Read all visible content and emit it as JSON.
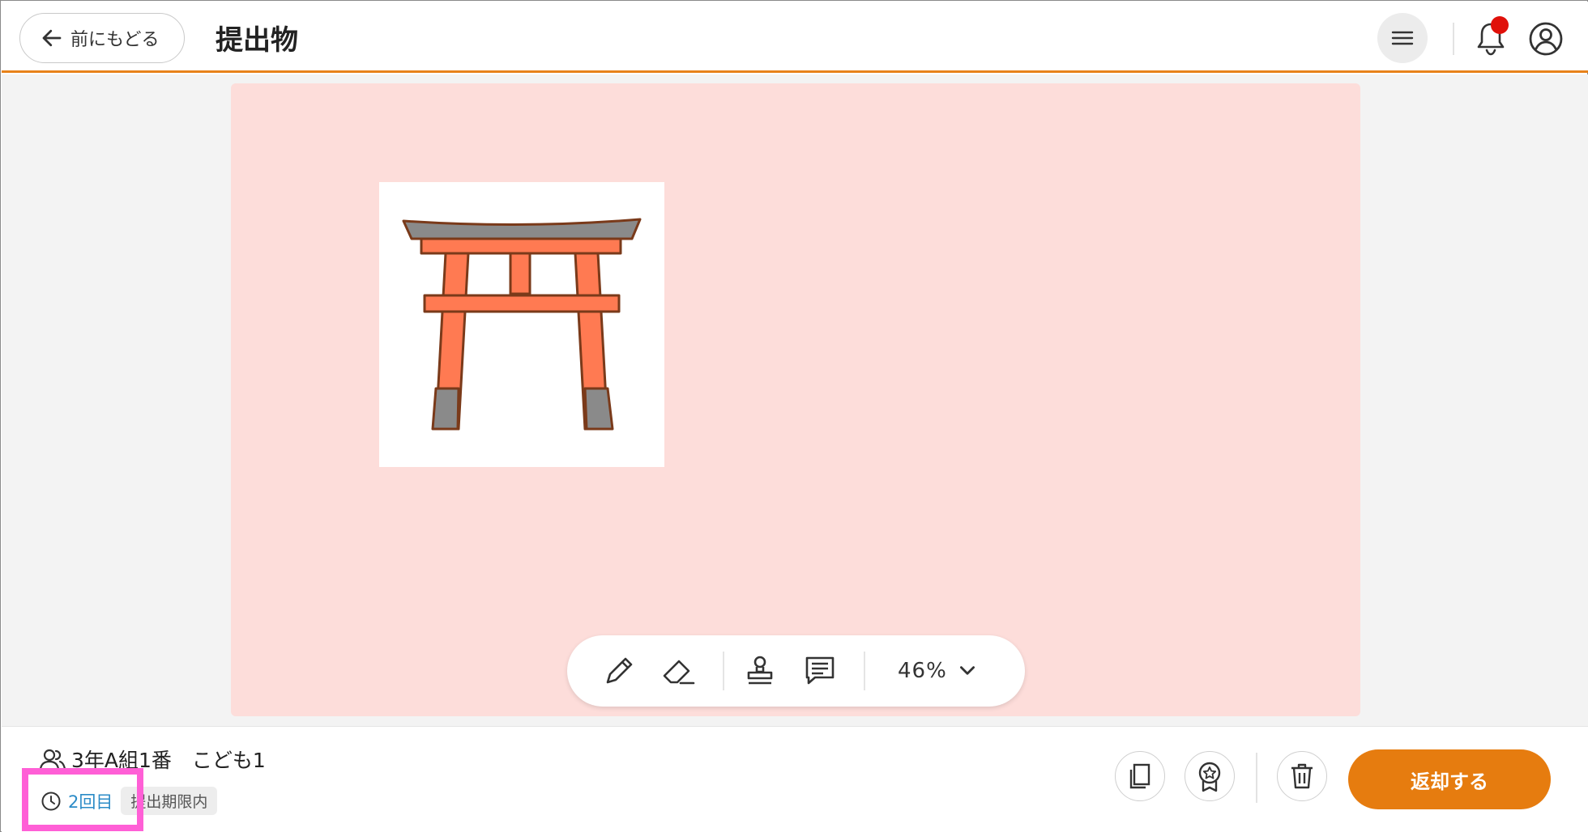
{
  "header": {
    "back_label": "前にもどる",
    "title": "提出物",
    "notification_dot_color": "#e0100a",
    "accent_color": "#e8821a"
  },
  "toolbar": {
    "tools": [
      "pencil-icon",
      "eraser-icon",
      "stamp-icon",
      "comment-icon"
    ],
    "zoom_value": "46%"
  },
  "student": {
    "name": "3年A組1番　こども1",
    "attempt": "2回目",
    "deadline_status": "提出期限内"
  },
  "footer": {
    "actions": [
      "copy-icon",
      "award-icon",
      "trash-icon"
    ],
    "return_label": "返却する"
  }
}
